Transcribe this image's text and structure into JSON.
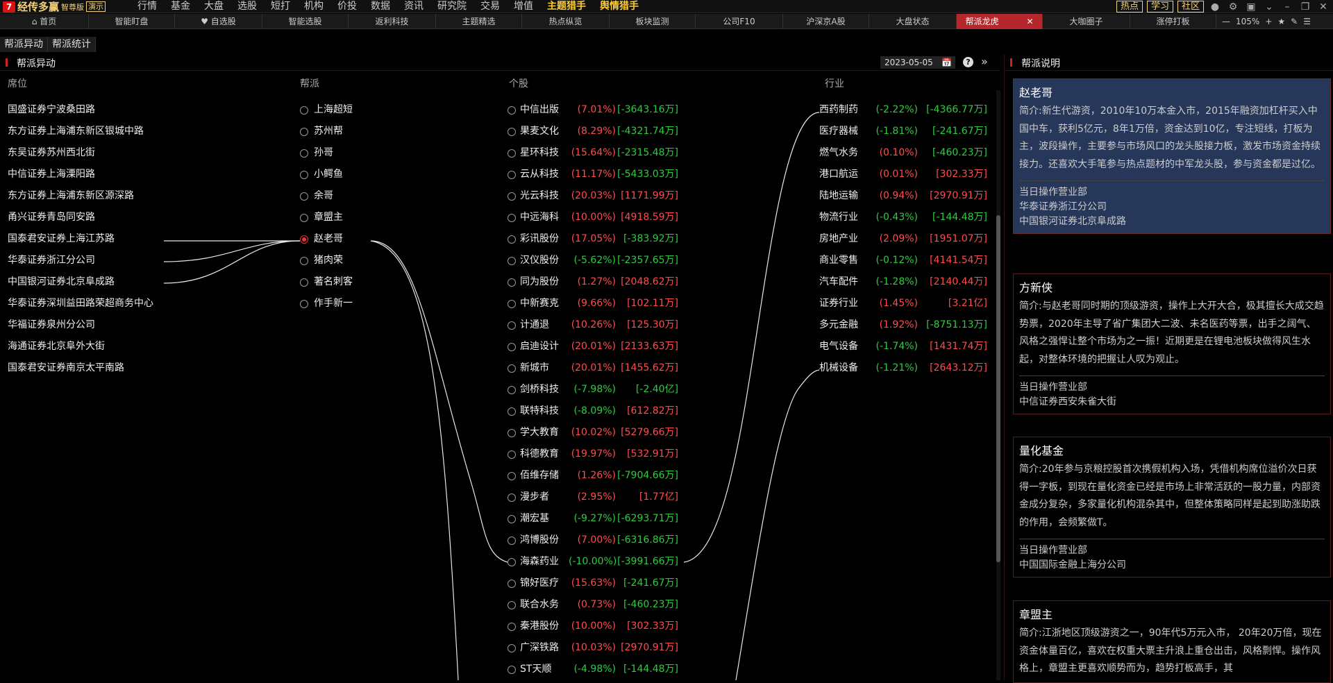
{
  "app": {
    "logo_mark": "7",
    "name": "经传多赢",
    "edition": "智尊版",
    "demo": "演示"
  },
  "main_nav": [
    {
      "label": "行情",
      "hl": false,
      "dot": false
    },
    {
      "label": "基金",
      "hl": false,
      "dot": false
    },
    {
      "label": "大盘",
      "hl": false,
      "dot": false
    },
    {
      "label": "选股",
      "hl": false,
      "dot": false
    },
    {
      "label": "短打",
      "hl": false,
      "dot": false
    },
    {
      "label": "机构",
      "hl": false,
      "dot": false
    },
    {
      "label": "价投",
      "hl": false,
      "dot": false
    },
    {
      "label": "数据",
      "hl": false,
      "dot": false
    },
    {
      "label": "资讯",
      "hl": false,
      "dot": false
    },
    {
      "label": "研究院",
      "hl": false,
      "dot": false
    },
    {
      "label": "交易",
      "hl": false,
      "dot": false
    },
    {
      "label": "增值",
      "hl": false,
      "dot": true
    },
    {
      "label": "主题猎手",
      "hl": true,
      "dot": true
    },
    {
      "label": "舆情猎手",
      "hl": true,
      "dot": true
    }
  ],
  "top_right": {
    "buttons": [
      "热点",
      "学习",
      "社区"
    ],
    "icons": [
      "user-icon",
      "gear-icon",
      "window-icon",
      "chevron-down-icon",
      "minimize-icon",
      "restore-icon",
      "close-icon"
    ]
  },
  "tabs": [
    {
      "label": "⌂ 首页",
      "w": 128
    },
    {
      "label": "智能盯盘",
      "w": 124
    },
    {
      "label": "♥ 自选股",
      "w": 126
    },
    {
      "label": "智能选股",
      "w": 124
    },
    {
      "label": "返利科技",
      "w": 126
    },
    {
      "label": "主题精选",
      "w": 124
    },
    {
      "label": "热点纵览",
      "w": 126
    },
    {
      "label": "板块监测",
      "w": 124
    },
    {
      "label": "公司F10",
      "w": 126
    },
    {
      "label": "沪深京A股",
      "w": 124
    },
    {
      "label": "大盘状态",
      "w": 126
    },
    {
      "label": "帮派龙虎",
      "w": 124,
      "active": true
    },
    {
      "label": "大咖圈子",
      "w": 126
    },
    {
      "label": "涨停打板",
      "w": 124
    }
  ],
  "zoom": {
    "minus": "—",
    "value": "105%",
    "plus": "+",
    "icons": [
      "star-icon",
      "pen-icon",
      "list-icon"
    ]
  },
  "subtabs": [
    {
      "label": "帮派异动",
      "active": true
    },
    {
      "label": "帮派统计",
      "active": false
    }
  ],
  "panel": {
    "title": "帮派异动",
    "date": "2023-05-05",
    "help": "?",
    "collapse": "»"
  },
  "columns": {
    "seat": "席位",
    "gang": "帮派",
    "stock": "个股",
    "industry": "行业"
  },
  "seats": [
    "国盛证券宁波桑田路",
    "东方证券上海浦东新区银城中路",
    "东吴证券苏州西北街",
    "中信证券上海溧阳路",
    "东方证券上海浦东新区源深路",
    "甬兴证券青岛同安路",
    "国泰君安证券上海江苏路",
    "华泰证券浙江分公司",
    "中国银河证券北京阜成路",
    "华泰证券深圳益田路荣超商务中心",
    "华福证券泉州分公司",
    "海通证券北京阜外大街",
    "国泰君安证券南京太平南路"
  ],
  "gangs": [
    {
      "label": "上海超短",
      "on": false
    },
    {
      "label": "苏州帮",
      "on": false
    },
    {
      "label": "孙哥",
      "on": false
    },
    {
      "label": "小鳄鱼",
      "on": false
    },
    {
      "label": "余哥",
      "on": false
    },
    {
      "label": "章盟主",
      "on": false
    },
    {
      "label": "赵老哥",
      "on": true
    },
    {
      "label": "猪肉荣",
      "on": false
    },
    {
      "label": "著名刺客",
      "on": false
    },
    {
      "label": "作手新一",
      "on": false
    }
  ],
  "stocks": [
    {
      "name": "中信出版",
      "pct": "(7.01%)",
      "amt": "[-3643.16万]",
      "pu": true,
      "au": false
    },
    {
      "name": "果麦文化",
      "pct": "(8.29%)",
      "amt": "[-4321.74万]",
      "pu": true,
      "au": false
    },
    {
      "name": "星环科技",
      "pct": "(15.64%)",
      "amt": "[-2315.48万]",
      "pu": true,
      "au": false
    },
    {
      "name": "云从科技",
      "pct": "(11.17%)",
      "amt": "[-5433.03万]",
      "pu": true,
      "au": false
    },
    {
      "name": "光云科技",
      "pct": "(20.03%)",
      "amt": "[1171.99万]",
      "pu": true,
      "au": true
    },
    {
      "name": "中远海科",
      "pct": "(10.00%)",
      "amt": "[4918.59万]",
      "pu": true,
      "au": true
    },
    {
      "name": "彩讯股份",
      "pct": "(17.05%)",
      "amt": "[-383.92万]",
      "pu": true,
      "au": false
    },
    {
      "name": "汉仪股份",
      "pct": "(-5.62%)",
      "amt": "[-2357.65万]",
      "pu": false,
      "au": false
    },
    {
      "name": "同为股份",
      "pct": "(1.27%)",
      "amt": "[2048.62万]",
      "pu": true,
      "au": true
    },
    {
      "name": "中新赛克",
      "pct": "(9.66%)",
      "amt": "[102.11万]",
      "pu": true,
      "au": true
    },
    {
      "name": "计通退",
      "pct": "(10.26%)",
      "amt": "[125.30万]",
      "pu": true,
      "au": true
    },
    {
      "name": "启迪设计",
      "pct": "(20.01%)",
      "amt": "[2133.63万]",
      "pu": true,
      "au": true
    },
    {
      "name": "新城市",
      "pct": "(20.01%)",
      "amt": "[1455.62万]",
      "pu": true,
      "au": true
    },
    {
      "name": "剑桥科技",
      "pct": "(-7.98%)",
      "amt": "[-2.40亿]",
      "pu": false,
      "au": false
    },
    {
      "name": "联特科技",
      "pct": "(-8.09%)",
      "amt": "[612.82万]",
      "pu": false,
      "au": true
    },
    {
      "name": "学大教育",
      "pct": "(10.02%)",
      "amt": "[5279.66万]",
      "pu": true,
      "au": true
    },
    {
      "name": "科德教育",
      "pct": "(19.97%)",
      "amt": "[532.91万]",
      "pu": true,
      "au": true
    },
    {
      "name": "佰维存储",
      "pct": "(1.26%)",
      "amt": "[-7904.66万]",
      "pu": true,
      "au": false
    },
    {
      "name": "漫步者",
      "pct": "(2.95%)",
      "amt": "[1.77亿]",
      "pu": true,
      "au": true
    },
    {
      "name": "潮宏基",
      "pct": "(-9.27%)",
      "amt": "[-6293.71万]",
      "pu": false,
      "au": false
    },
    {
      "name": "鸿博股份",
      "pct": "(7.00%)",
      "amt": "[-6316.86万]",
      "pu": true,
      "au": false
    },
    {
      "name": "海森药业",
      "pct": "(-10.00%)",
      "amt": "[-3991.66万]",
      "pu": false,
      "au": false
    },
    {
      "name": "锦好医疗",
      "pct": "(15.63%)",
      "amt": "[-241.67万]",
      "pu": true,
      "au": false
    },
    {
      "name": "联合水务",
      "pct": "(0.73%)",
      "amt": "[-460.23万]",
      "pu": true,
      "au": false
    },
    {
      "name": "秦港股份",
      "pct": "(10.00%)",
      "amt": "[302.33万]",
      "pu": true,
      "au": true
    },
    {
      "name": "广深铁路",
      "pct": "(10.03%)",
      "amt": "[2970.91万]",
      "pu": true,
      "au": true
    },
    {
      "name": "ST天顺",
      "pct": "(-4.98%)",
      "amt": "[-144.48万]",
      "pu": false,
      "au": false
    }
  ],
  "industries": [
    {
      "name": "西药制药",
      "pct": "(-2.22%)",
      "amt": "[-4366.77万]",
      "pu": false,
      "au": false
    },
    {
      "name": "医疗器械",
      "pct": "(-1.81%)",
      "amt": "[-241.67万]",
      "pu": false,
      "au": false
    },
    {
      "name": "燃气水务",
      "pct": "(0.10%)",
      "amt": "[-460.23万]",
      "pu": true,
      "au": false
    },
    {
      "name": "港口航运",
      "pct": "(0.01%)",
      "amt": "[302.33万]",
      "pu": true,
      "au": true
    },
    {
      "name": "陆地运输",
      "pct": "(0.94%)",
      "amt": "[2970.91万]",
      "pu": true,
      "au": true
    },
    {
      "name": "物流行业",
      "pct": "(-0.43%)",
      "amt": "[-144.48万]",
      "pu": false,
      "au": false
    },
    {
      "name": "房地产业",
      "pct": "(2.09%)",
      "amt": "[1951.07万]",
      "pu": true,
      "au": true
    },
    {
      "name": "商业零售",
      "pct": "(-0.12%)",
      "amt": "[4141.54万]",
      "pu": false,
      "au": true
    },
    {
      "name": "汽车配件",
      "pct": "(-1.28%)",
      "amt": "[2140.44万]",
      "pu": false,
      "au": true
    },
    {
      "name": "证券行业",
      "pct": "(1.45%)",
      "amt": "[3.21亿]",
      "pu": true,
      "au": true
    },
    {
      "name": "多元金融",
      "pct": "(1.92%)",
      "amt": "[-8751.13万]",
      "pu": true,
      "au": false
    },
    {
      "name": "电气设备",
      "pct": "(-1.74%)",
      "amt": "[1431.74万]",
      "pu": false,
      "au": true
    },
    {
      "name": "机械设备",
      "pct": "(-1.21%)",
      "amt": "[2643.12万]",
      "pu": false,
      "au": true
    }
  ],
  "right_panel": {
    "title": "帮派说明",
    "cards": [
      {
        "name": "赵老哥",
        "desc": "简介:新生代游资，2010年10万本金入市，2015年融资加杠杆买入中国中车，获利5亿元，8年1万倍，资金达到10亿，专注短线，打板为主，波段操作，主要参与市场风口的龙头股接力板，激发市场资金持续接力。还喜欢大手笔参与热点题材的中军龙头股，参与资金都是过亿。",
        "branch_label": "当日操作营业部",
        "branches": [
          "华泰证券浙江分公司",
          "中国银河证券北京阜成路"
        ],
        "selected": true
      },
      {
        "name": "方新侠",
        "desc": "简介:与赵老哥同时期的顶级游资，操作上大开大合，极其擅长大成交趋势票，2020年主导了省广集团大二波、未名医药等票，出手之阔气、风格之强悍让整个市场为之一振！近期更是在锂电池板块做得风生水起，对整体环境的把握让人叹为观止。",
        "branch_label": "当日操作营业部",
        "branches": [
          "中信证券西安朱雀大街"
        ],
        "selected": false
      },
      {
        "name": "量化基金",
        "desc": "简介:20年参与京粮控股首次携假机构入场，凭借机构席位溢价次日获得一字板，到现在量化资金已经是市场上非常活跃的一股力量，内部资金成分复杂，多家量化机构混杂其中，但整体策略同样是起到助涨助跌的作用，会频繁做T。",
        "branch_label": "当日操作营业部",
        "branches": [
          "中国国际金融上海分公司"
        ],
        "selected": false
      },
      {
        "name": "章盟主",
        "desc": "简介:江浙地区顶级游资之一，90年代5万元入市， 20年20万倍，现在资金体量百亿，喜欢在权重大票主升浪上重仓出击，风格剽悍。操作风格上，章盟主更喜欢顺势而为，趋势打板高手，其",
        "branch_label": "",
        "branches": [],
        "selected": false
      }
    ]
  },
  "colors": {
    "up": "#ff4d4d",
    "down": "#2ecc40",
    "accent": "#b4282d",
    "gold": "#f5d27a"
  }
}
